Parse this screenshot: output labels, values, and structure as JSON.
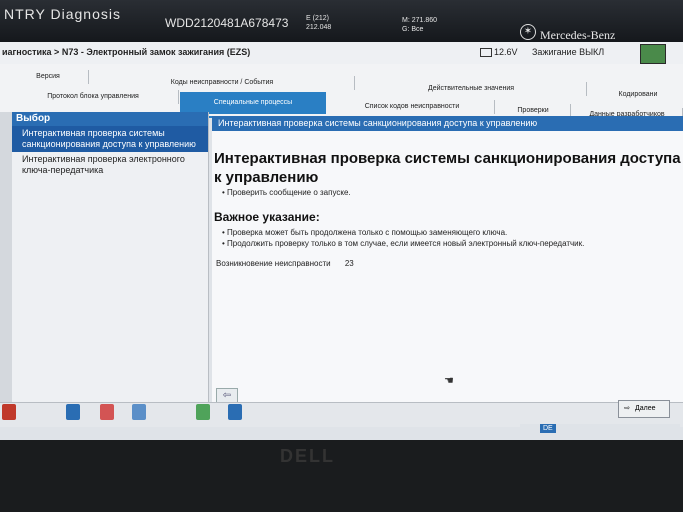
{
  "header": {
    "app_title": "NTRY Diagnosis",
    "vin": "WDD2120481A678473",
    "model_line1": "E (212)",
    "model_line2": "212.048",
    "mileage_line1": "M: 271.860",
    "mileage_line2": "G: Все",
    "brand": "Mercedes-Benz"
  },
  "crumb": "иагностика > N73 - Электронный замок зажигания (EZS)",
  "status": {
    "voltage": "12.6V",
    "ignition": "Зажигание ВЫКЛ"
  },
  "tabs": [
    {
      "label": "Версия"
    },
    {
      "label": "Коды неисправности / События"
    },
    {
      "label": "Действительные значения"
    },
    {
      "label": "Кодировани"
    },
    {
      "label": "Протокол блока управления"
    },
    {
      "label": "Специальные процессы"
    },
    {
      "label": "Список кодов неисправности"
    },
    {
      "label": "Проверки"
    },
    {
      "label": "Данные разработчиков"
    }
  ],
  "sidebar": {
    "title": "Выбор",
    "items": [
      {
        "label": "Интерактивная проверка системы санкционирования доступа к управлению"
      },
      {
        "label": "Интерактивная проверка электронного ключа-передатчика"
      }
    ]
  },
  "main": {
    "header": "Интерактивная проверка системы санкционирования доступа к управлению",
    "title": "Интерактивная проверка системы санкционирования доступа к управлению",
    "step": "Проверить сообщение о запуске.",
    "note_title": "Важное указание:",
    "notes": [
      "Проверка может быть продолжена только с помощью заменяющего ключа.",
      "Продолжить проверку только в том случае, если имеется новый электронный ключ-передатчик."
    ],
    "fault_label": "Возникновение неисправности",
    "fault_value": "23"
  },
  "next_label": "Далее",
  "tray": {
    "lang": "DE"
  },
  "bezel_logo": "DELL"
}
